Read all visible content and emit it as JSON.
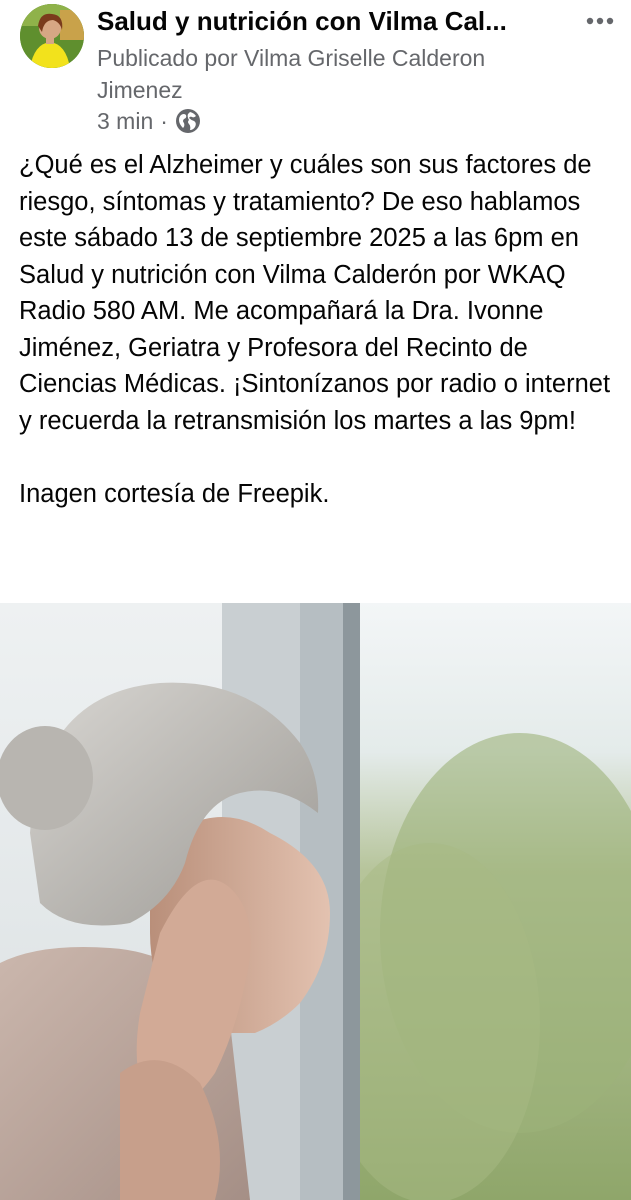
{
  "post": {
    "page_name": "Salud y nutrición con Vilma Cal...",
    "posted_by": "Publicado por Vilma Griselle Calderon Jimenez",
    "time": "3 min",
    "separator": "·",
    "audience_icon": "globe-icon",
    "more_icon": "more-horizontal-icon",
    "body": "¿Qué es el Alzheimer y cuáles son sus factores de riesgo, síntomas y tratamiento? De eso hablamos este sábado 13 de septiembre 2025 a las 6pm en Salud y nutrición con Vilma Calderón por WKAQ Radio 580 AM. Me acompañará la Dra. Ivonne Jiménez, Geriatra y Profesora del Recinto de Ciencias Médicas. ¡Sintonízanos por radio o internet y recuerda la retransmisión los martes a las 9pm!",
    "caption": "Inagen cortesía de Freepik."
  },
  "colors": {
    "text_primary": "#050505",
    "text_secondary": "#65676b"
  }
}
